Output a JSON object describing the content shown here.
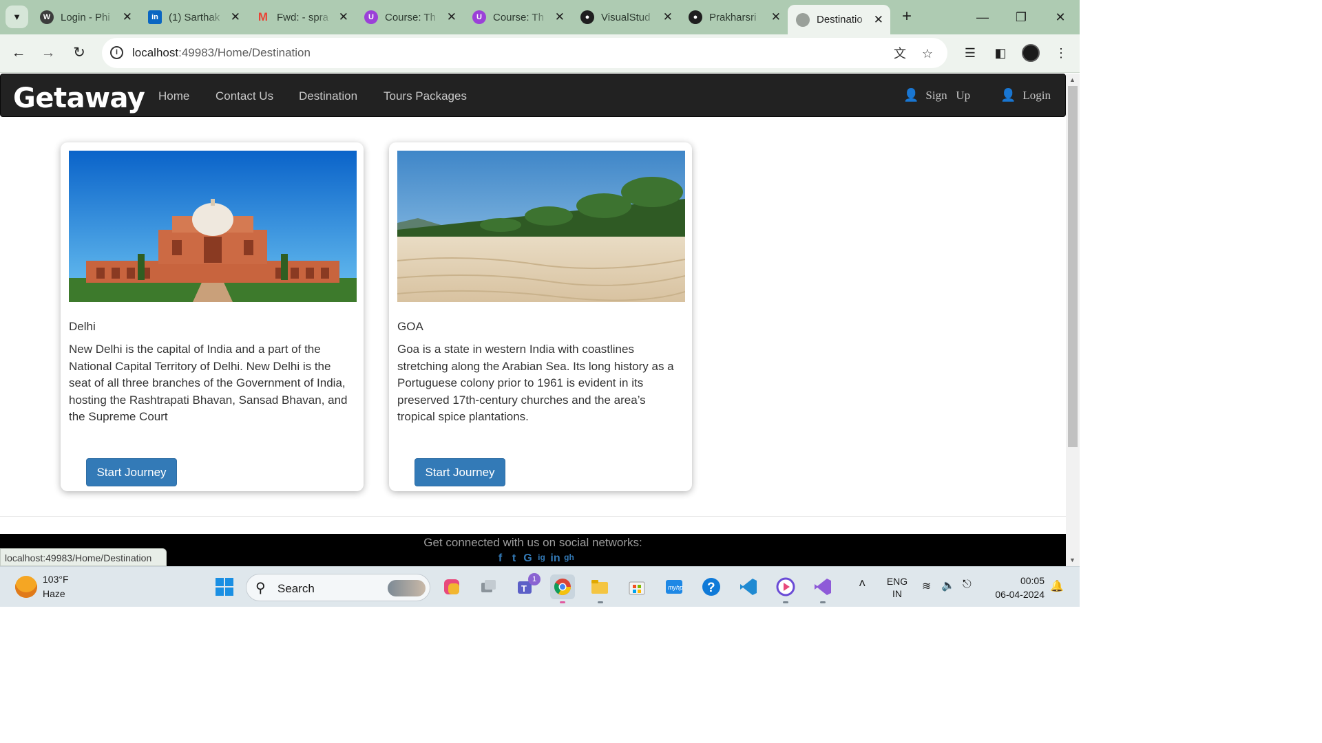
{
  "browser": {
    "tabs": [
      {
        "title": "Login - Phi",
        "favicon": "wordpress-icon",
        "favicon_color": "#3c3c3c"
      },
      {
        "title": "(1) Sarthak",
        "favicon": "linkedin-icon",
        "favicon_color": "#0a66c2"
      },
      {
        "title": "Fwd: - spra",
        "favicon": "gmail-icon",
        "favicon_color": "#ea4335"
      },
      {
        "title": "Course: Th",
        "favicon": "course-icon",
        "favicon_color": "#9b40d8"
      },
      {
        "title": "Course: Th",
        "favicon": "course-icon",
        "favicon_color": "#9b40d8"
      },
      {
        "title": "VisualStud",
        "favicon": "github-icon",
        "favicon_color": "#1f1f1f"
      },
      {
        "title": "Prakharsri",
        "favicon": "github-icon",
        "favicon_color": "#1f1f1f"
      },
      {
        "title": "Destinatio",
        "favicon": "globe-icon",
        "favicon_color": "#8a8f8a",
        "active": true
      }
    ],
    "url_host": "localhost",
    "url_rest": ":49983/Home/Destination",
    "status_url": "localhost:49983/Home/Destination"
  },
  "site": {
    "brand": "Getaway",
    "nav": [
      "Home",
      "Contact Us",
      "Destination",
      "Tours Packages"
    ],
    "signup": "Sign   Up",
    "login": "Login",
    "cards": [
      {
        "title": "Delhi",
        "description": "New Delhi is the capital of India and a part of the National Capital Territory of Delhi. New Delhi is the seat of all three branches of the Government of India, hosting the Rashtrapati Bhavan, Sansad Bhavan, and the Supreme Court",
        "button": "Start Journey"
      },
      {
        "title": "GOA",
        "description": "Goa is a state in western India with coastlines stretching along the Arabian Sea. Its long history as a Portuguese colony prior to 1961 is evident in its preserved 17th-century churches and the area’s tropical spice plantations.",
        "button": "Start Journey"
      }
    ],
    "footer_text": "Get connected with us on social networks:",
    "social": [
      "f",
      "t",
      "G",
      "ig",
      "in",
      "gh"
    ]
  },
  "taskbar": {
    "temperature": "103°F",
    "condition": "Haze",
    "search_label": "Search",
    "language": "ENG",
    "region": "IN",
    "time": "00:05",
    "date": "06-04-2024",
    "teams_badge": "1"
  },
  "colors": {
    "accent": "#337ab7",
    "navbar": "#222222",
    "tabstrip": "#aecbb2"
  }
}
